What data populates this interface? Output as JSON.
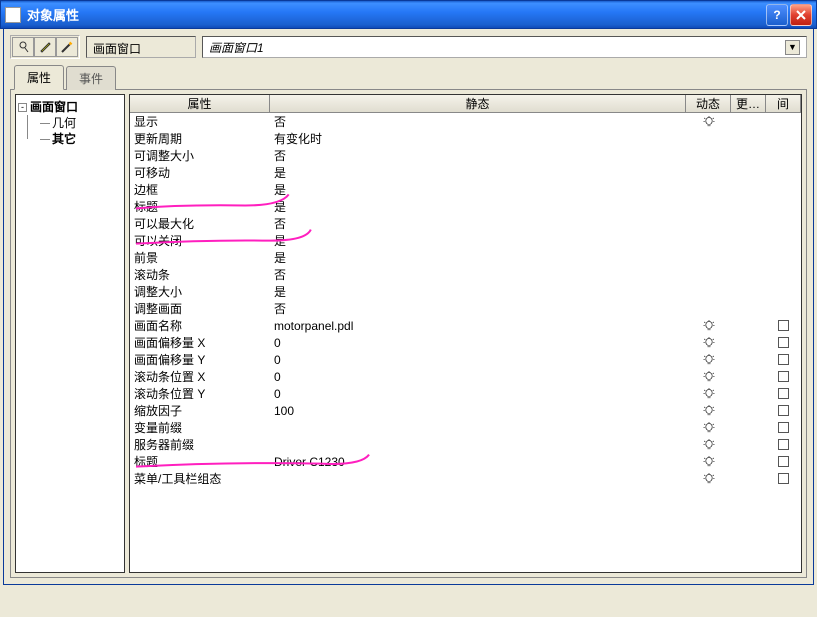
{
  "window": {
    "title": "对象属性"
  },
  "toolbar": {
    "object_type": "画面窗口",
    "object_name": "画面窗口1"
  },
  "tabs": {
    "attributes": "属性",
    "events": "事件"
  },
  "tree": {
    "root": "画面窗口",
    "geometry": "几何",
    "other": "其它"
  },
  "grid": {
    "head": {
      "attr": "属性",
      "static": "静态",
      "dynamic": "动态",
      "more": "更…",
      "ind": "间"
    },
    "rows": [
      {
        "attr": "显示",
        "val": "否",
        "dyn": true,
        "chk": false
      },
      {
        "attr": "更新周期",
        "val": "有变化时",
        "dyn": false,
        "chk": false
      },
      {
        "attr": "可调整大小",
        "val": "否",
        "dyn": false,
        "chk": false
      },
      {
        "attr": "可移动",
        "val": "是",
        "dyn": false,
        "chk": false
      },
      {
        "attr": "边框",
        "val": "是",
        "dyn": false,
        "chk": false
      },
      {
        "attr": "标题",
        "val": "是",
        "dyn": false,
        "chk": false
      },
      {
        "attr": "可以最大化",
        "val": "否",
        "dyn": false,
        "chk": false
      },
      {
        "attr": "可以关闭",
        "val": "是",
        "dyn": false,
        "chk": false
      },
      {
        "attr": "前景",
        "val": "是",
        "dyn": false,
        "chk": false
      },
      {
        "attr": "滚动条",
        "val": "否",
        "dyn": false,
        "chk": false
      },
      {
        "attr": "调整大小",
        "val": "是",
        "dyn": false,
        "chk": false
      },
      {
        "attr": "调整画面",
        "val": "否",
        "dyn": false,
        "chk": false
      },
      {
        "attr": "画面名称",
        "val": "motorpanel.pdl",
        "dyn": true,
        "chk": true
      },
      {
        "attr": "画面偏移量  X",
        "val": "0",
        "dyn": true,
        "chk": true
      },
      {
        "attr": "画面偏移量  Y",
        "val": "0",
        "dyn": true,
        "chk": true
      },
      {
        "attr": "滚动条位置 X",
        "val": "0",
        "dyn": true,
        "chk": true
      },
      {
        "attr": "滚动条位置 Y",
        "val": "0",
        "dyn": true,
        "chk": true
      },
      {
        "attr": "缩放因子",
        "val": "100",
        "dyn": true,
        "chk": true
      },
      {
        "attr": "变量前缀",
        "val": "",
        "dyn": true,
        "chk": true
      },
      {
        "attr": "服务器前缀",
        "val": "",
        "dyn": true,
        "chk": true
      },
      {
        "attr": "标题",
        "val": "Driver C1230",
        "dyn": true,
        "chk": true
      },
      {
        "attr": "菜单/工具栏组态",
        "val": "",
        "dyn": true,
        "chk": true
      }
    ]
  }
}
